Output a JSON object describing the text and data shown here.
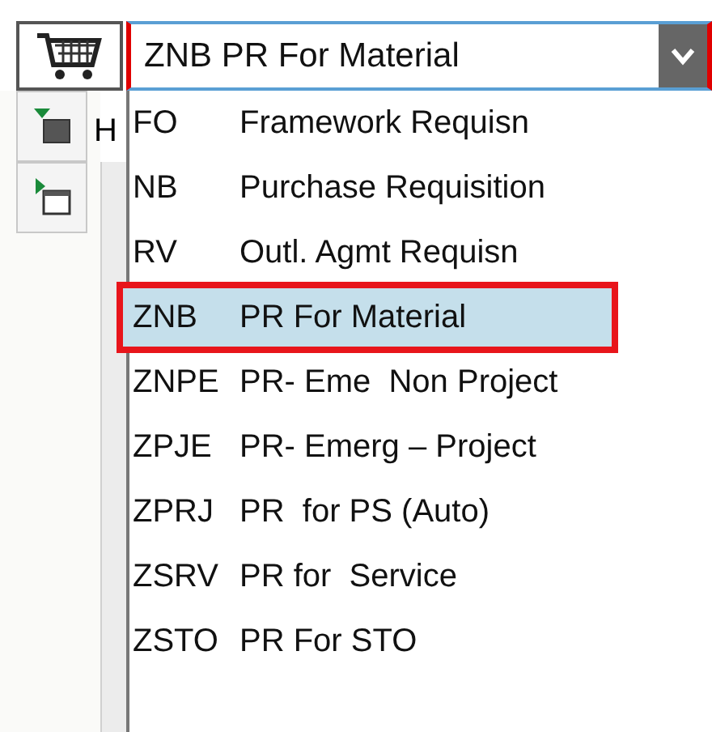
{
  "combobox": {
    "value": "ZNB PR For Material",
    "annotated": true
  },
  "partial_label": "H",
  "options": [
    {
      "code": "FO",
      "text": "Framework Requisn",
      "selected": false,
      "annotated": false
    },
    {
      "code": "NB",
      "text": "Purchase Requisition",
      "selected": false,
      "annotated": false
    },
    {
      "code": "RV",
      "text": "Outl. Agmt Requisn",
      "selected": false,
      "annotated": false
    },
    {
      "code": "ZNB",
      "text": "PR For Material",
      "selected": true,
      "annotated": true
    },
    {
      "code": "ZNPE",
      "text": "PR- Eme  Non Project",
      "selected": false,
      "annotated": false
    },
    {
      "code": "ZPJE",
      "text": "PR- Emerg – Project",
      "selected": false,
      "annotated": false
    },
    {
      "code": "ZPRJ",
      "text": "PR  for PS (Auto)",
      "selected": false,
      "annotated": false
    },
    {
      "code": "ZSRV",
      "text": "PR for  Service",
      "selected": false,
      "annotated": false
    },
    {
      "code": "ZSTO",
      "text": "PR For STO",
      "selected": false,
      "annotated": false
    }
  ]
}
